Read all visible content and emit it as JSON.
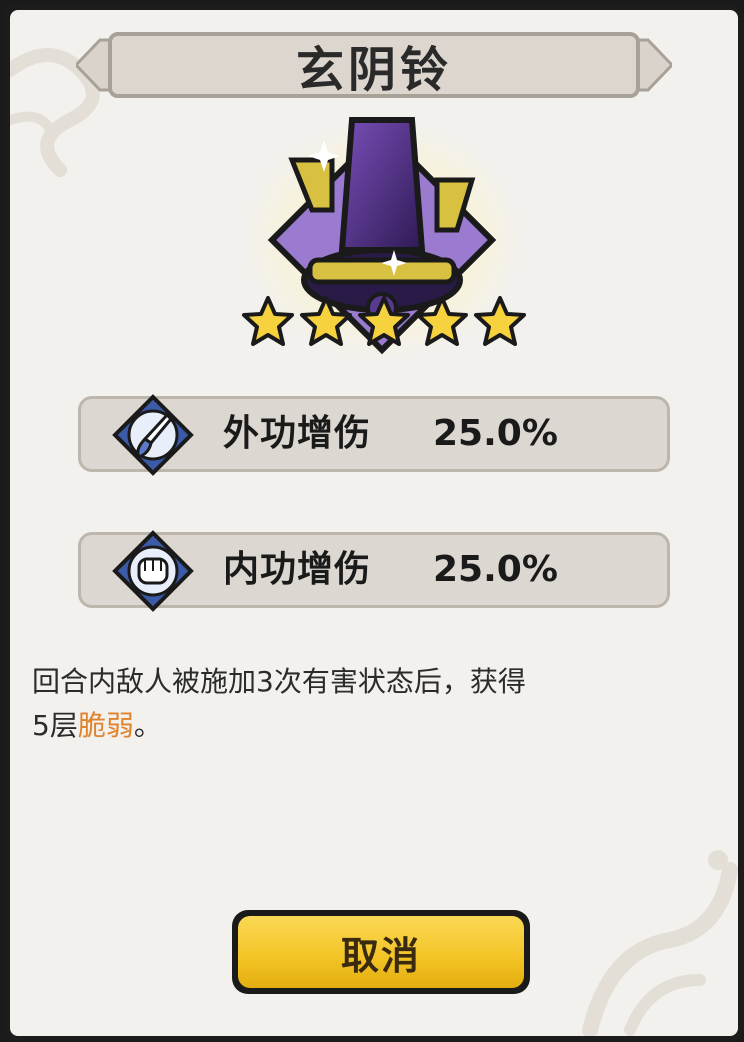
{
  "title": "玄阴铃",
  "star_count": 5,
  "stats": [
    {
      "icon": "brush-icon",
      "label": "外功增伤",
      "value": "25.0%"
    },
    {
      "icon": "fist-icon",
      "label": "内功增伤",
      "value": "25.0%"
    }
  ],
  "description": {
    "line1": "回合内敌人被施加3次有害状态后，获得",
    "line2_prefix": "5层",
    "line2_highlight": "脆弱",
    "line2_suffix": "。"
  },
  "cancel_label": "取消",
  "colors": {
    "panel_bg": "#f3f1ee",
    "stat_bg": "#dcd7d0",
    "highlight": "#e0832d",
    "button": "#f2c324",
    "star": "#f6d23e"
  },
  "item_icon": "purple-bell-icon"
}
